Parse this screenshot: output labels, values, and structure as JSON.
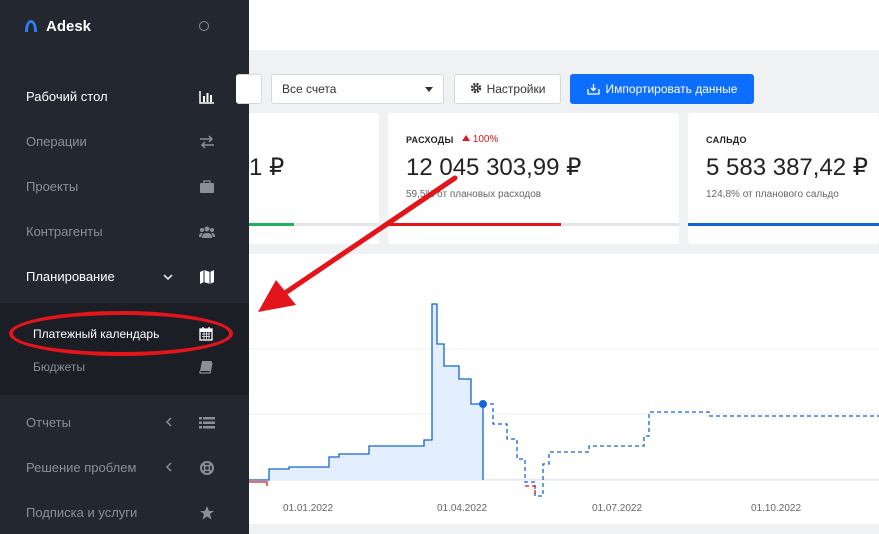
{
  "app": {
    "name": "Adesk"
  },
  "sidebar": {
    "items": [
      {
        "label": "Рабочий стол",
        "icon": "bar-chart-icon",
        "active": true
      },
      {
        "label": "Операции",
        "icon": "exchange-icon",
        "active": false
      },
      {
        "label": "Проекты",
        "icon": "briefcase-icon",
        "active": false
      },
      {
        "label": "Контрагенты",
        "icon": "users-icon",
        "active": false
      },
      {
        "label": "Планирование",
        "icon": "map-icon",
        "active": true
      },
      {
        "label": "Отчеты",
        "icon": "list-icon",
        "active": false
      },
      {
        "label": "Решение проблем",
        "icon": "lifebuoy-icon",
        "active": false
      },
      {
        "label": "Подписка и услуги",
        "icon": "star-icon",
        "active": false
      }
    ],
    "submenu": [
      {
        "label": "Платежный календарь",
        "icon": "calendar-icon",
        "active": true
      },
      {
        "label": "Бюджеты",
        "icon": "book-icon",
        "active": false
      }
    ]
  },
  "toolbar": {
    "accounts_select": "Все счета",
    "settings_label": "Настройки",
    "import_label": "Импортировать данные"
  },
  "cards": {
    "income": {
      "value_fragment": "1 ₽",
      "bar_color": "#1fb25a"
    },
    "expenses": {
      "title": "РАСХОДЫ",
      "delta": "100%",
      "value": "12 045 303,99 ₽",
      "sub": "59,5% от плановых расходов",
      "bar_color": "#e4141b",
      "progress": 0.595
    },
    "balance": {
      "title": "САЛЬДО",
      "value": "5 583 387,42 ₽",
      "sub": "124,8% от планового сальдо",
      "bar_color": "#1464d6",
      "progress": 1.0
    }
  },
  "chart_data": {
    "type": "line",
    "x_ticks": [
      "01.01.2022",
      "01.04.2022",
      "01.07.2022",
      "01.10.2022"
    ],
    "series": [
      {
        "style": "actual",
        "color": "#1464d6",
        "values": [
          0,
          0.1,
          0.1,
          0.12,
          0.12,
          0.22,
          0.22,
          0.24,
          1.0,
          0.6,
          0.6,
          0.45,
          0.45,
          0.4
        ]
      },
      {
        "style": "plan",
        "color": "#1464d6",
        "values": [
          0.4,
          0.3,
          0.2,
          0.2,
          0.1,
          -0.1,
          -0.1,
          0.2,
          0.22,
          0.22,
          0.4,
          0.4,
          0.4,
          0.36,
          0.36
        ]
      }
    ],
    "highlight_color": "#e4141b"
  },
  "annotation": {
    "color": "#e4141b"
  }
}
